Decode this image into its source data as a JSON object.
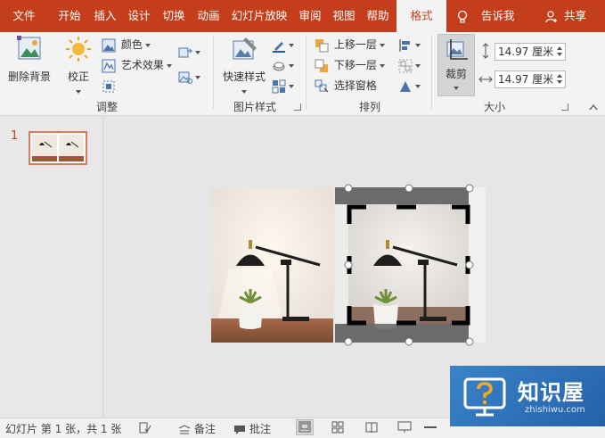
{
  "tabs": [
    {
      "label": "文件"
    },
    {
      "label": "开始"
    },
    {
      "label": "插入"
    },
    {
      "label": "设计"
    },
    {
      "label": "切换"
    },
    {
      "label": "动画"
    },
    {
      "label": "幻灯片放映"
    },
    {
      "label": "审阅"
    },
    {
      "label": "视图"
    },
    {
      "label": "帮助"
    },
    {
      "label": "格式"
    }
  ],
  "active_tab": "格式",
  "tell_me": "告诉我",
  "share": "共享",
  "ribbon": {
    "adjust": {
      "remove_bg": "删除背景",
      "correct": "校正",
      "color": "颜色",
      "art_effects": "艺术效果",
      "group": "调整"
    },
    "picture_styles": {
      "quick_styles": "快速样式",
      "group": "图片样式"
    },
    "arrange": {
      "bring_forward": "上移一层",
      "send_backward": "下移一层",
      "selection_pane": "选择窗格",
      "group": "排列"
    },
    "size": {
      "crop": "裁剪",
      "height": "14.97 厘米",
      "width": "14.97 厘米",
      "group": "大小"
    }
  },
  "thumbnails": {
    "slide_number": "1"
  },
  "status": {
    "slide_info": "幻灯片 第 1 张，共 1 张",
    "notes": "备注",
    "comments": "批注"
  },
  "watermark": {
    "title": "知识屋",
    "subtitle": "zhishiwu.com"
  },
  "colors": {
    "accent": "#c43e1c",
    "selection": "#e07a5f",
    "watermark": "#2f74bd"
  }
}
